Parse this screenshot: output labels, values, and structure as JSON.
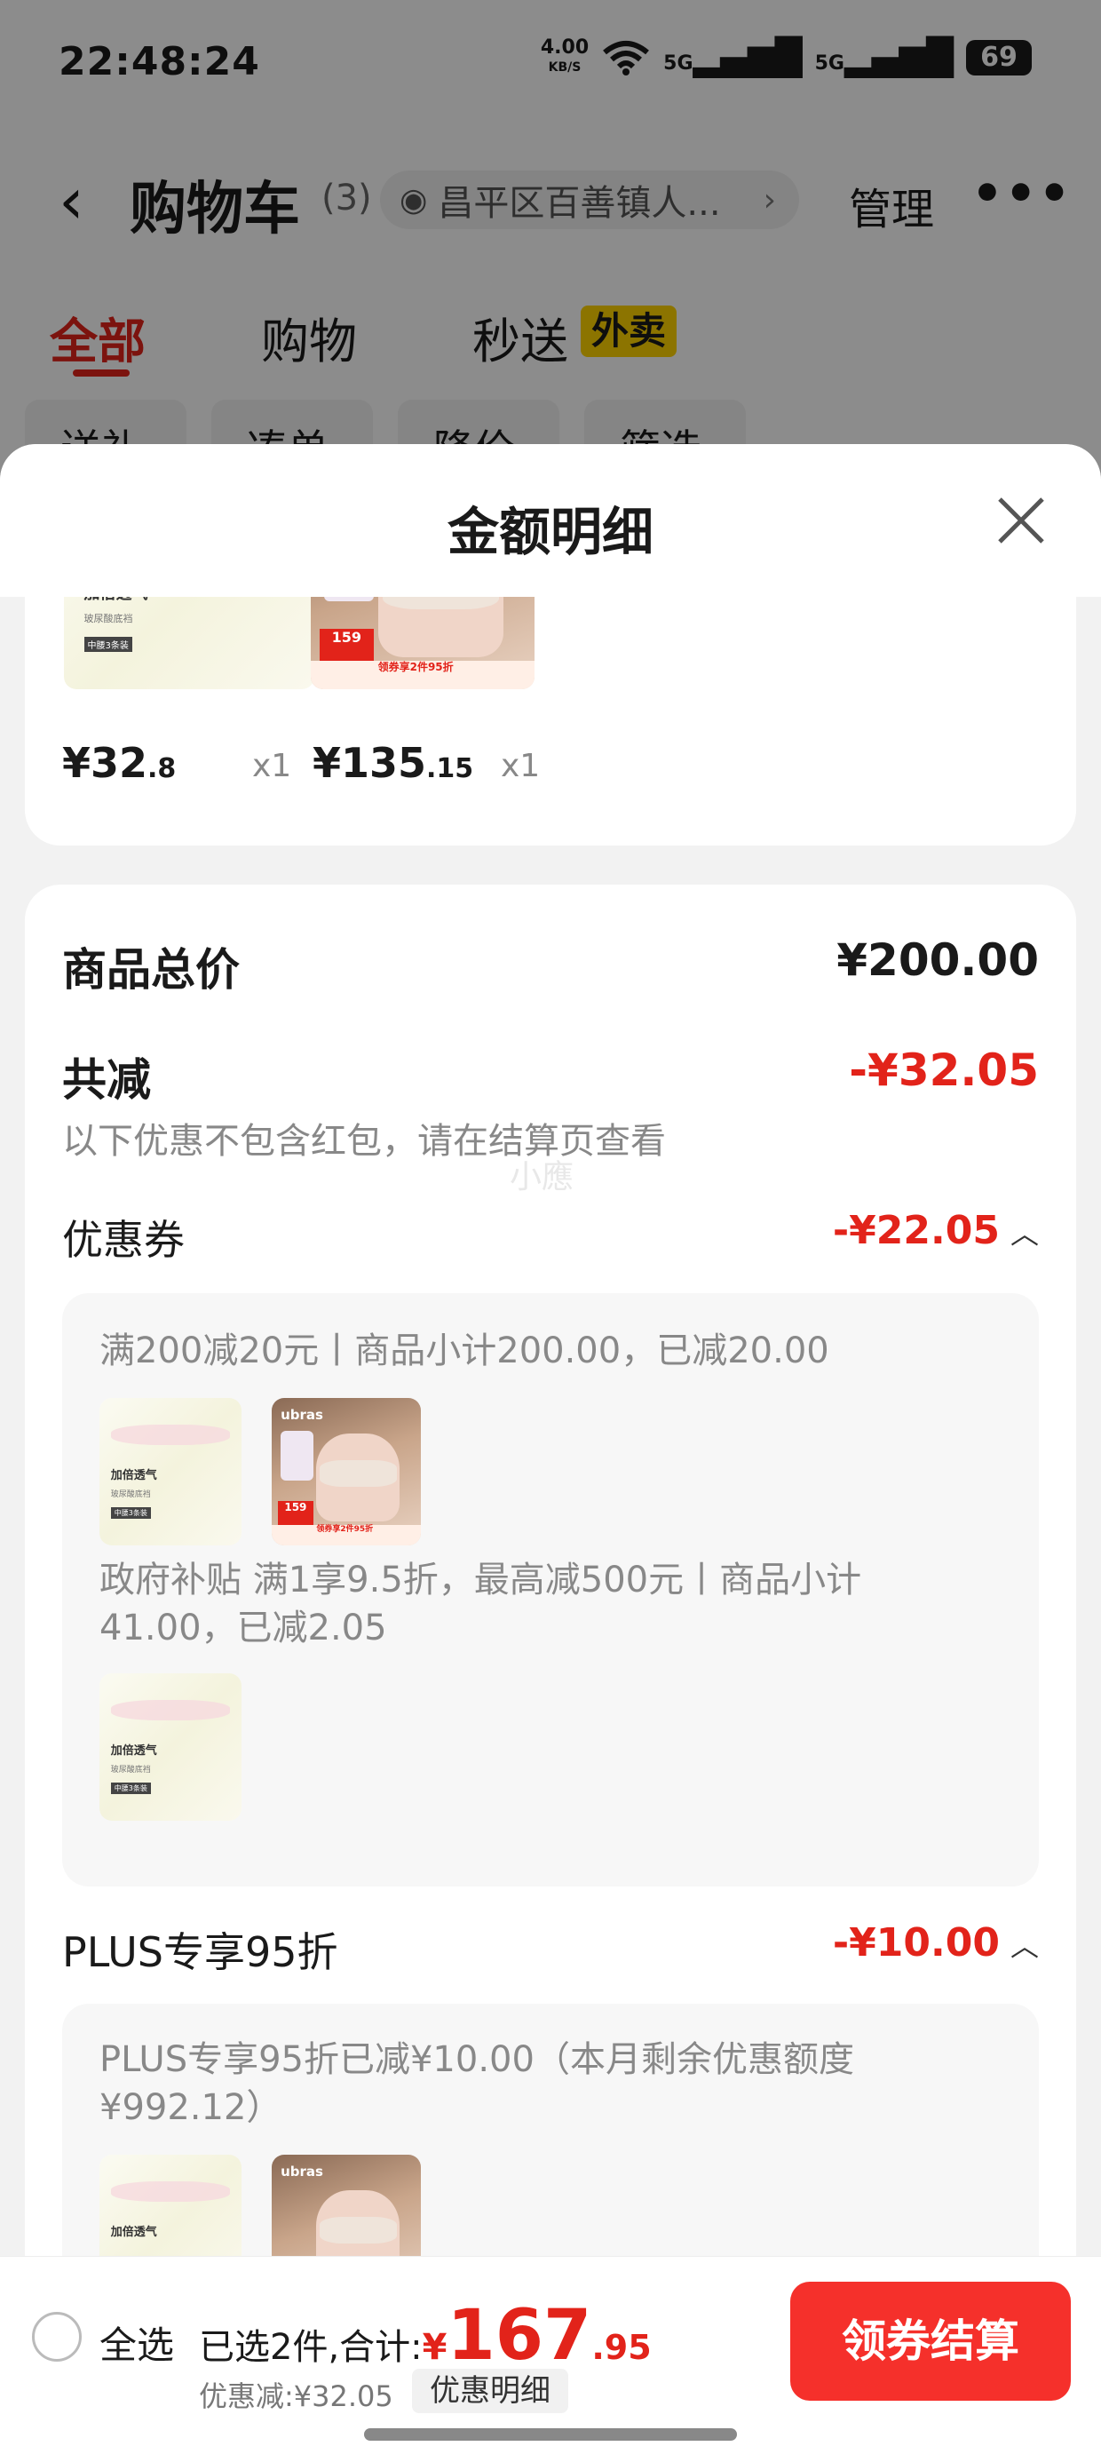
{
  "status_bar": {
    "time": "22:48:24",
    "net_speed": "4.00",
    "net_unit": "KB/S",
    "signal1": "5G",
    "signal2": "5G",
    "battery": "69"
  },
  "nav": {
    "title": "购物车",
    "count": "(3)",
    "address": "昌平区百善镇人...",
    "manage_label": "管理"
  },
  "tabs": [
    {
      "label": "全部",
      "active": true
    },
    {
      "label": "购物",
      "active": false
    },
    {
      "label": "秒送",
      "active": false,
      "badge": "外卖"
    }
  ],
  "chips": [
    "送礼",
    "凑单",
    "降价",
    "筛选"
  ],
  "sheet": {
    "title": "金额明细",
    "items": [
      {
        "price_int": "¥32",
        "price_dec": ".8",
        "qty": "x1",
        "thumb_title": "加倍透气",
        "thumb_sub": "玻尿酸底裆",
        "thumb_tag": "中腰3条装"
      },
      {
        "price_int": "¥135",
        "price_dec": ".15",
        "qty": "x1",
        "thumb_brand": "ubras",
        "thumb_price": "159",
        "thumb_strip": "领券享2件95折"
      }
    ],
    "summary": {
      "total_label": "商品总价",
      "total_value": "¥200.00",
      "reduce_label": "共减",
      "reduce_value": "-¥32.05",
      "reduce_note": "以下优惠不包含红包，请在结算页查看",
      "watermark": "小應"
    },
    "coupon": {
      "label": "优惠券",
      "value": "-¥22.05",
      "line1": "满200减20元丨商品小计200.00，已减20.00",
      "line2": "政府补贴 满1享9.5折，最高减500元丨商品小计41.00，已减2.05"
    },
    "plus": {
      "label": "PLUS专享95折",
      "value": "-¥10.00",
      "line1": "PLUS专享95折已减¥10.00（本月剩余优惠额度¥992.12）"
    }
  },
  "bottom_bar": {
    "select_all": "全选",
    "selected_text": "已选2件,合计:",
    "total_yen": "¥",
    "total_int": "167",
    "total_dec": ".95",
    "discount_text": "优惠减:¥32.05",
    "detail_label": "优惠明细",
    "checkout_label": "领券结算"
  }
}
